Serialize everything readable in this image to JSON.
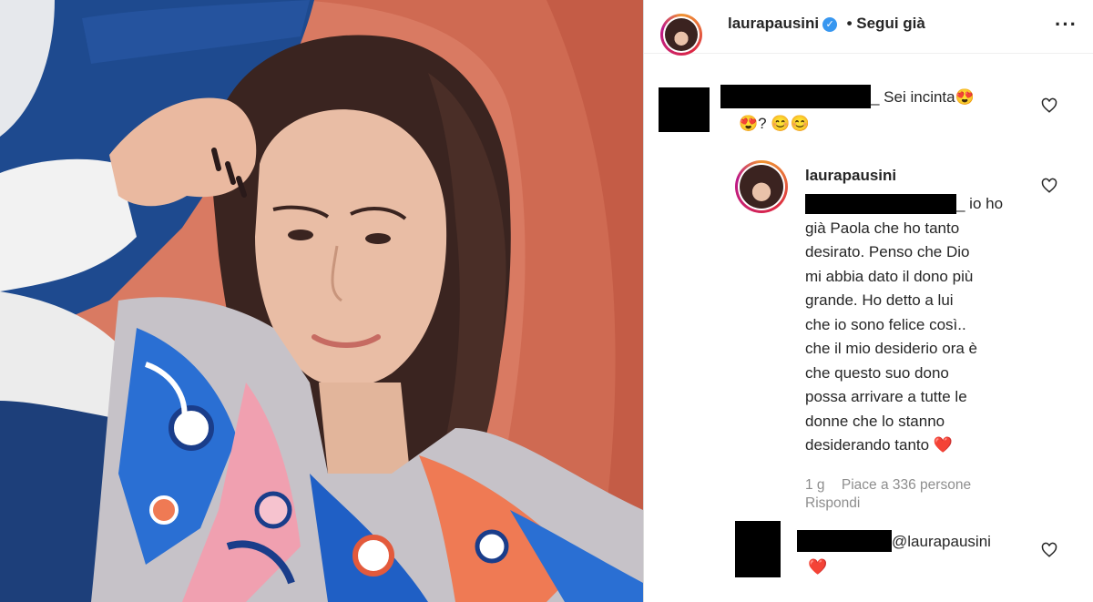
{
  "post": {
    "author": "laurapausini",
    "follow_label": "• Segui già",
    "more_label": "···"
  },
  "comments": [
    {
      "text": "_ Sei incinta😍",
      "text2": "😍? 😊😊"
    },
    {
      "author": "laurapausini",
      "lines": [
        "_ io ho",
        "già Paola che ho tanto",
        "desirato. Penso che Dio",
        "mi abbia dato il dono più",
        "grande. Ho detto a lui",
        "che io sono felice così..",
        "che il mio desiderio ora è",
        "che questo suo dono",
        "possa arrivare a tutte le",
        "donne che lo stanno",
        "desiderando tanto ❤️"
      ],
      "time": "1 g",
      "likes": "Piace a 336 persone",
      "reply_label": "Rispondi"
    },
    {
      "text": "@laurapausini",
      "text2": "❤️"
    }
  ],
  "colors": {
    "verified": "#3897f0",
    "heart": "#ed4956",
    "sofa_blue": "#1e4a8f",
    "sofa_coral": "#d76a53"
  }
}
